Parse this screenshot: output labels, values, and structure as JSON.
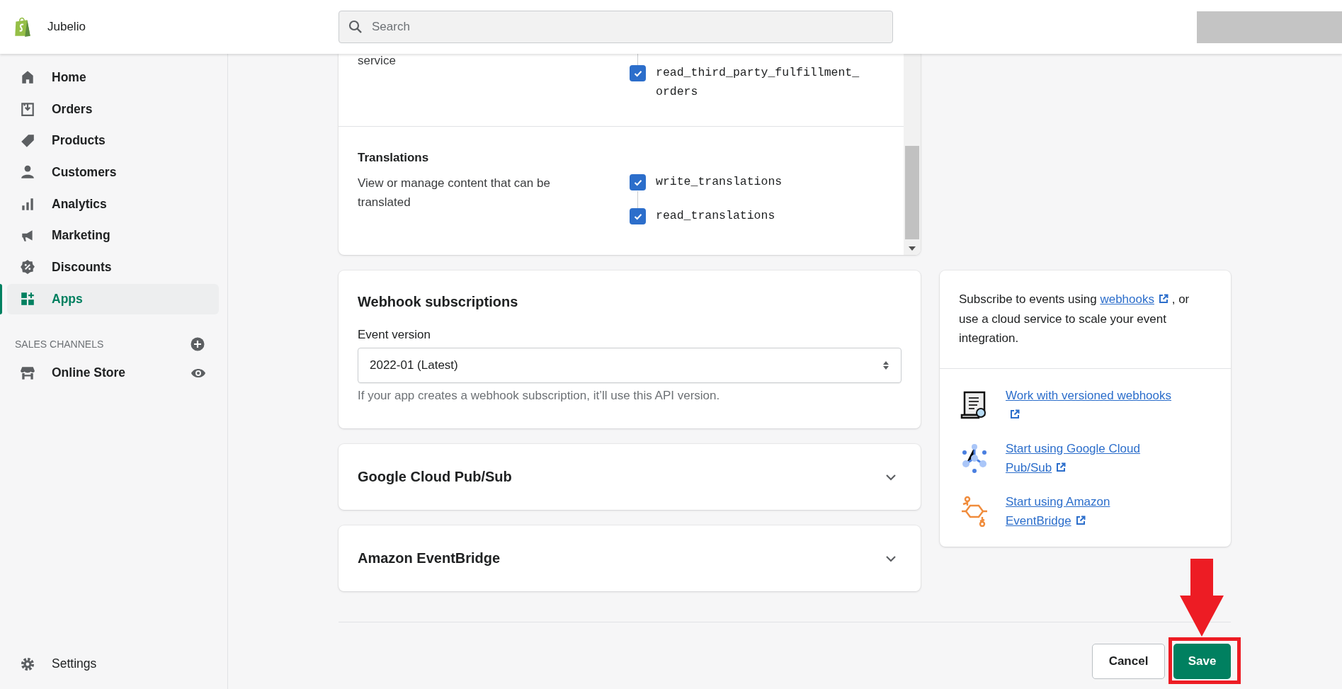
{
  "store": {
    "name": "Jubelio"
  },
  "search": {
    "placeholder": "Search"
  },
  "sidebar": {
    "items": [
      {
        "label": "Home",
        "selected": false
      },
      {
        "label": "Orders",
        "selected": false
      },
      {
        "label": "Products",
        "selected": false
      },
      {
        "label": "Customers",
        "selected": false
      },
      {
        "label": "Analytics",
        "selected": false
      },
      {
        "label": "Marketing",
        "selected": false
      },
      {
        "label": "Discounts",
        "selected": false
      },
      {
        "label": "Apps",
        "selected": true
      }
    ],
    "sales_channels": {
      "heading": "SALES CHANNELS",
      "items": [
        {
          "label": "Online Store"
        }
      ]
    },
    "settings": {
      "label": "Settings"
    }
  },
  "scopes": [
    {
      "description": "service",
      "scopes": [
        {
          "name": "read_third_party_fulfillment_orders",
          "checked": true
        }
      ]
    },
    {
      "title": "Translations",
      "description": "View or manage content that can be translated",
      "scopes": [
        {
          "name": "write_translations",
          "checked": true
        },
        {
          "name": "read_translations",
          "checked": true
        }
      ]
    }
  ],
  "webhooks": {
    "title": "Webhook subscriptions",
    "label": "Event version",
    "value": "2022-01 (Latest)",
    "help": "If your app creates a webhook subscription, it’ll use this API version."
  },
  "collapsibles": [
    {
      "title": "Google Cloud Pub/Sub",
      "expanded": false
    },
    {
      "title": "Amazon EventBridge",
      "expanded": false
    }
  ],
  "aside": {
    "intro_before": "Subscribe to events using ",
    "intro_link": "webhooks",
    "intro_after": " , or use a cloud service to scale your event integration.",
    "resources": [
      {
        "text": "Work with versioned webhooks",
        "kind": "document"
      },
      {
        "text": "Start using Google Cloud Pub/Sub",
        "kind": "pubsub"
      },
      {
        "text": "Start using Amazon EventBridge",
        "kind": "eventbridge"
      }
    ]
  },
  "footer": {
    "cancel": "Cancel",
    "save": "Save"
  }
}
